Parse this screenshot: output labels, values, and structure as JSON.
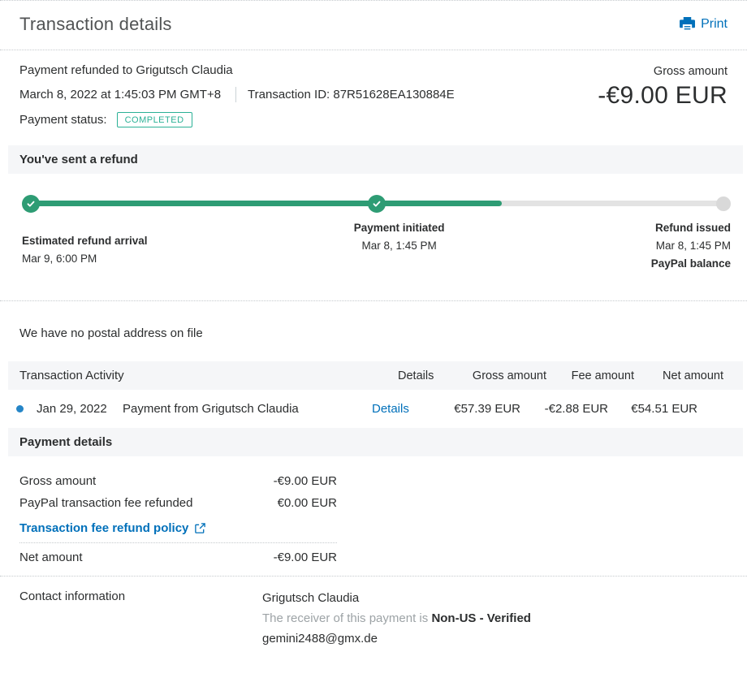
{
  "header": {
    "title": "Transaction details",
    "print_label": "Print"
  },
  "summary": {
    "refund_to": "Payment refunded to Grigutsch Claudia",
    "date": "March 8, 2022 at 1:45:03 PM GMT+8",
    "transaction_id": "Transaction ID: 87R51628EA130884E",
    "payment_status_label": "Payment status:",
    "payment_status_value": "COMPLETED",
    "gross_amount_label": "Gross amount",
    "gross_amount_value": "-€9.00 EUR"
  },
  "refund_timeline": {
    "title": "You've sent a refund",
    "progress_percent": 66.5,
    "steps": [
      {
        "label": "Estimated refund arrival",
        "time": "Mar 9, 6:00 PM"
      },
      {
        "label": "Payment initiated",
        "time": "Mar 8, 1:45 PM"
      },
      {
        "label": "Refund issued",
        "time": "Mar 8, 1:45 PM",
        "sublabel": "PayPal balance"
      }
    ]
  },
  "postal_note": "We have no postal address on file",
  "activity": {
    "title": "Transaction Activity",
    "columns": [
      "Details",
      "Gross amount",
      "Fee amount",
      "Net amount"
    ],
    "rows": [
      {
        "date": "Jan 29, 2022",
        "description": "Payment from Grigutsch Claudia",
        "details_label": "Details",
        "gross": "€57.39 EUR",
        "fee": "-€2.88 EUR",
        "net": "€54.51 EUR"
      }
    ]
  },
  "payment_details": {
    "title": "Payment details",
    "rows": [
      {
        "label": "Gross amount",
        "value": "-€9.00 EUR"
      },
      {
        "label": "PayPal transaction fee refunded",
        "value": "€0.00 EUR"
      }
    ],
    "policy_link": "Transaction fee refund policy",
    "net_label": "Net amount",
    "net_value": "-€9.00 EUR"
  },
  "contact": {
    "label": "Contact information",
    "name": "Grigutsch Claudia",
    "receiver_note": "The receiver of this payment is",
    "receiver_status": "Non-US - Verified",
    "email": "gemini2488@gmx.de"
  },
  "colors": {
    "accent_blue": "#0070ba",
    "success_green": "#2e9c74",
    "badge_teal": "#2bb196",
    "section_bg": "#f5f6f8"
  }
}
